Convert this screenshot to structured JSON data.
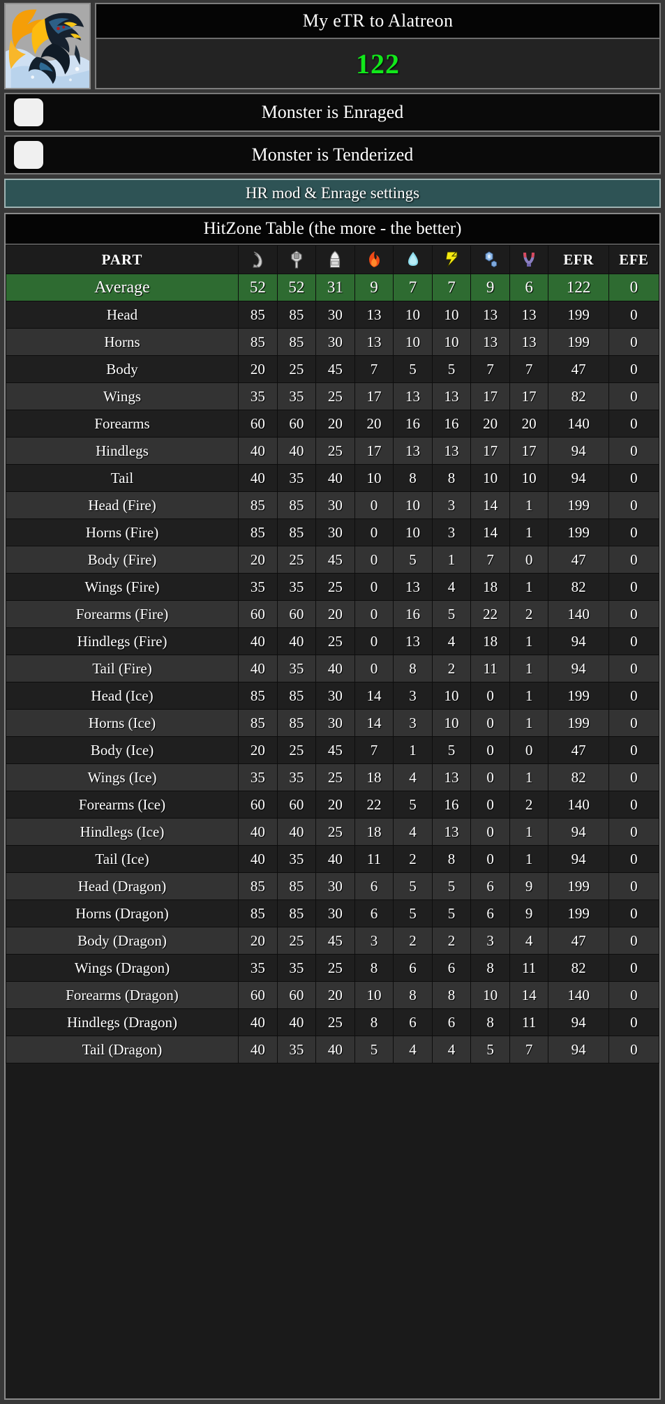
{
  "header": {
    "portrait_alt": "alatreon-monster-icon",
    "title": "My eTR to Alatreon",
    "etr_value": "122",
    "etr_color": "#12e81b"
  },
  "toggles": [
    {
      "name": "enraged",
      "label": "Monster is Enraged",
      "checked": false
    },
    {
      "name": "tenderized",
      "label": "Monster is Tenderized",
      "checked": false
    }
  ],
  "settings_button": {
    "label": "HR mod & Enrage settings",
    "color": "#2e5355"
  },
  "table": {
    "title": "HitZone Table (the more - the better)",
    "headers": {
      "part": "PART",
      "sever": "sever-icon",
      "blunt": "blunt-icon",
      "shot": "shot-icon",
      "fire": "fire-element-icon",
      "water": "water-element-icon",
      "thunder": "thunder-element-icon",
      "ice": "ice-element-icon",
      "dragon": "dragon-element-icon",
      "efr": "EFR",
      "efe": "EFE"
    },
    "average_row": {
      "part": "Average",
      "values": [
        "52",
        "52",
        "31",
        "9",
        "7",
        "7",
        "9",
        "6",
        "122",
        "0"
      ]
    },
    "rows": [
      {
        "part": "Head",
        "values": [
          "85",
          "85",
          "30",
          "13",
          "10",
          "10",
          "13",
          "13",
          "199",
          "0"
        ]
      },
      {
        "part": "Horns",
        "values": [
          "85",
          "85",
          "30",
          "13",
          "10",
          "10",
          "13",
          "13",
          "199",
          "0"
        ]
      },
      {
        "part": "Body",
        "values": [
          "20",
          "25",
          "45",
          "7",
          "5",
          "5",
          "7",
          "7",
          "47",
          "0"
        ]
      },
      {
        "part": "Wings",
        "values": [
          "35",
          "35",
          "25",
          "17",
          "13",
          "13",
          "17",
          "17",
          "82",
          "0"
        ]
      },
      {
        "part": "Forearms",
        "values": [
          "60",
          "60",
          "20",
          "20",
          "16",
          "16",
          "20",
          "20",
          "140",
          "0"
        ]
      },
      {
        "part": "Hindlegs",
        "values": [
          "40",
          "40",
          "25",
          "17",
          "13",
          "13",
          "17",
          "17",
          "94",
          "0"
        ]
      },
      {
        "part": "Tail",
        "values": [
          "40",
          "35",
          "40",
          "10",
          "8",
          "8",
          "10",
          "10",
          "94",
          "0"
        ]
      },
      {
        "part": "Head (Fire)",
        "values": [
          "85",
          "85",
          "30",
          "0",
          "10",
          "3",
          "14",
          "1",
          "199",
          "0"
        ]
      },
      {
        "part": "Horns (Fire)",
        "values": [
          "85",
          "85",
          "30",
          "0",
          "10",
          "3",
          "14",
          "1",
          "199",
          "0"
        ]
      },
      {
        "part": "Body (Fire)",
        "values": [
          "20",
          "25",
          "45",
          "0",
          "5",
          "1",
          "7",
          "0",
          "47",
          "0"
        ]
      },
      {
        "part": "Wings (Fire)",
        "values": [
          "35",
          "35",
          "25",
          "0",
          "13",
          "4",
          "18",
          "1",
          "82",
          "0"
        ]
      },
      {
        "part": "Forearms (Fire)",
        "values": [
          "60",
          "60",
          "20",
          "0",
          "16",
          "5",
          "22",
          "2",
          "140",
          "0"
        ]
      },
      {
        "part": "Hindlegs (Fire)",
        "values": [
          "40",
          "40",
          "25",
          "0",
          "13",
          "4",
          "18",
          "1",
          "94",
          "0"
        ]
      },
      {
        "part": "Tail (Fire)",
        "values": [
          "40",
          "35",
          "40",
          "0",
          "8",
          "2",
          "11",
          "1",
          "94",
          "0"
        ]
      },
      {
        "part": "Head (Ice)",
        "values": [
          "85",
          "85",
          "30",
          "14",
          "3",
          "10",
          "0",
          "1",
          "199",
          "0"
        ]
      },
      {
        "part": "Horns (Ice)",
        "values": [
          "85",
          "85",
          "30",
          "14",
          "3",
          "10",
          "0",
          "1",
          "199",
          "0"
        ]
      },
      {
        "part": "Body (Ice)",
        "values": [
          "20",
          "25",
          "45",
          "7",
          "1",
          "5",
          "0",
          "0",
          "47",
          "0"
        ]
      },
      {
        "part": "Wings (Ice)",
        "values": [
          "35",
          "35",
          "25",
          "18",
          "4",
          "13",
          "0",
          "1",
          "82",
          "0"
        ]
      },
      {
        "part": "Forearms (Ice)",
        "values": [
          "60",
          "60",
          "20",
          "22",
          "5",
          "16",
          "0",
          "2",
          "140",
          "0"
        ]
      },
      {
        "part": "Hindlegs (Ice)",
        "values": [
          "40",
          "40",
          "25",
          "18",
          "4",
          "13",
          "0",
          "1",
          "94",
          "0"
        ]
      },
      {
        "part": "Tail (Ice)",
        "values": [
          "40",
          "35",
          "40",
          "11",
          "2",
          "8",
          "0",
          "1",
          "94",
          "0"
        ]
      },
      {
        "part": "Head (Dragon)",
        "values": [
          "85",
          "85",
          "30",
          "6",
          "5",
          "5",
          "6",
          "9",
          "199",
          "0"
        ]
      },
      {
        "part": "Horns (Dragon)",
        "values": [
          "85",
          "85",
          "30",
          "6",
          "5",
          "5",
          "6",
          "9",
          "199",
          "0"
        ]
      },
      {
        "part": "Body (Dragon)",
        "values": [
          "20",
          "25",
          "45",
          "3",
          "2",
          "2",
          "3",
          "4",
          "47",
          "0"
        ]
      },
      {
        "part": "Wings (Dragon)",
        "values": [
          "35",
          "35",
          "25",
          "8",
          "6",
          "6",
          "8",
          "11",
          "82",
          "0"
        ]
      },
      {
        "part": "Forearms (Dragon)",
        "values": [
          "60",
          "60",
          "20",
          "10",
          "8",
          "8",
          "10",
          "14",
          "140",
          "0"
        ]
      },
      {
        "part": "Hindlegs (Dragon)",
        "values": [
          "40",
          "40",
          "25",
          "8",
          "6",
          "6",
          "8",
          "11",
          "94",
          "0"
        ]
      },
      {
        "part": "Tail (Dragon)",
        "values": [
          "40",
          "35",
          "40",
          "5",
          "4",
          "4",
          "5",
          "7",
          "94",
          "0"
        ]
      }
    ]
  }
}
